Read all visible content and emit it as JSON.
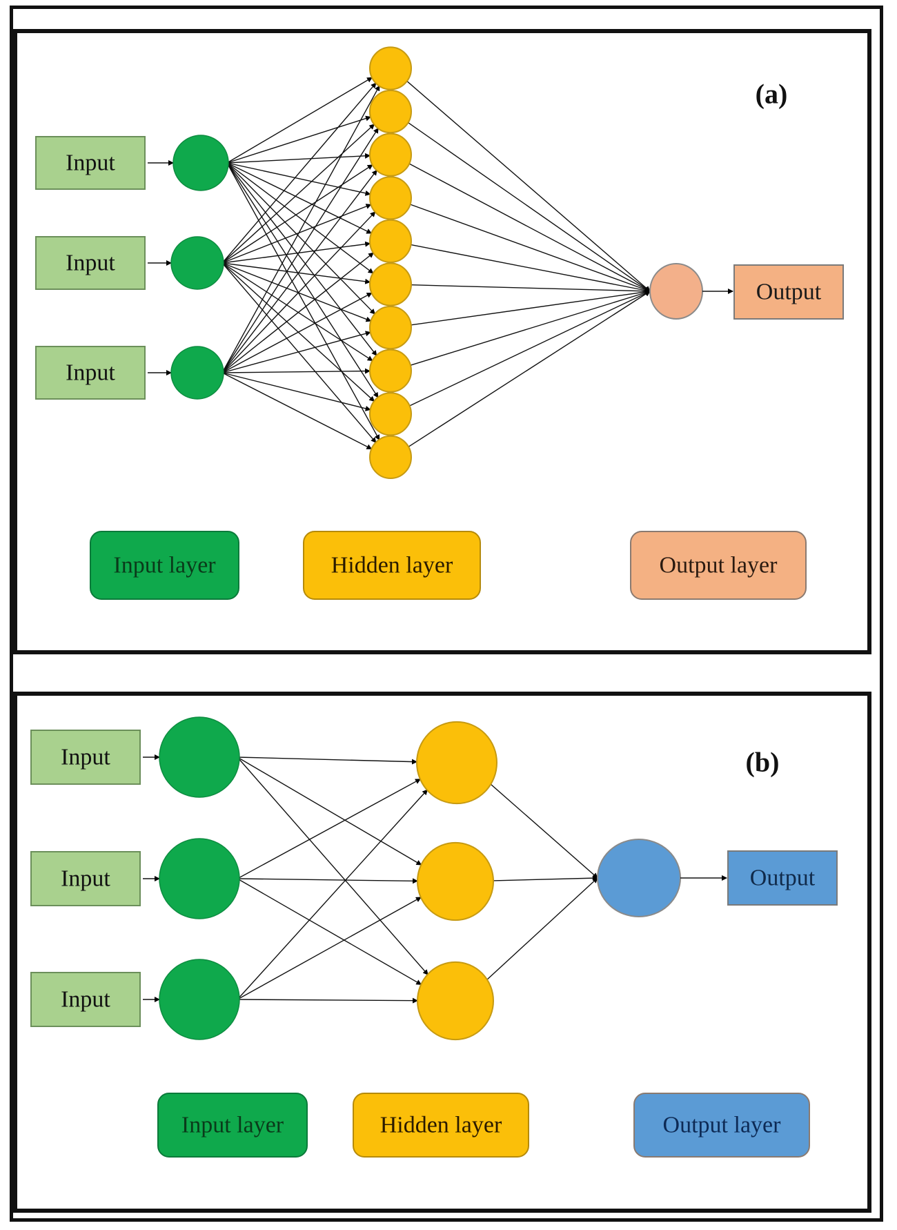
{
  "panels": [
    {
      "label": "(a)",
      "inputs": [
        "Input",
        "Input",
        "Input"
      ],
      "hidden_count": 10,
      "output_label": "Output",
      "legend": [
        "Input layer",
        "Hidden layer",
        "Output layer"
      ],
      "colors": {
        "input_box": "#a9d18e",
        "input_node": "#0fa94c",
        "hidden_node": "#fbbf09",
        "output_node": "#f3b08a",
        "output_box": "#f4b183",
        "legend_input": "#0fa94c",
        "legend_hidden": "#fbbf09",
        "legend_output": "#f4b183",
        "output_text": "#1a1a1a"
      }
    },
    {
      "label": "(b)",
      "inputs": [
        "Input",
        "Input",
        "Input"
      ],
      "hidden_count": 3,
      "output_label": "Output",
      "legend": [
        "Input layer",
        "Hidden layer",
        "Output layer"
      ],
      "colors": {
        "input_box": "#a9d18e",
        "input_node": "#0fa94c",
        "hidden_node": "#fbbf09",
        "output_node": "#5b9bd5",
        "output_box": "#5b9bd5",
        "legend_input": "#0fa94c",
        "legend_hidden": "#fbbf09",
        "legend_output": "#5b9bd5",
        "output_text": "#102a4a"
      }
    }
  ]
}
